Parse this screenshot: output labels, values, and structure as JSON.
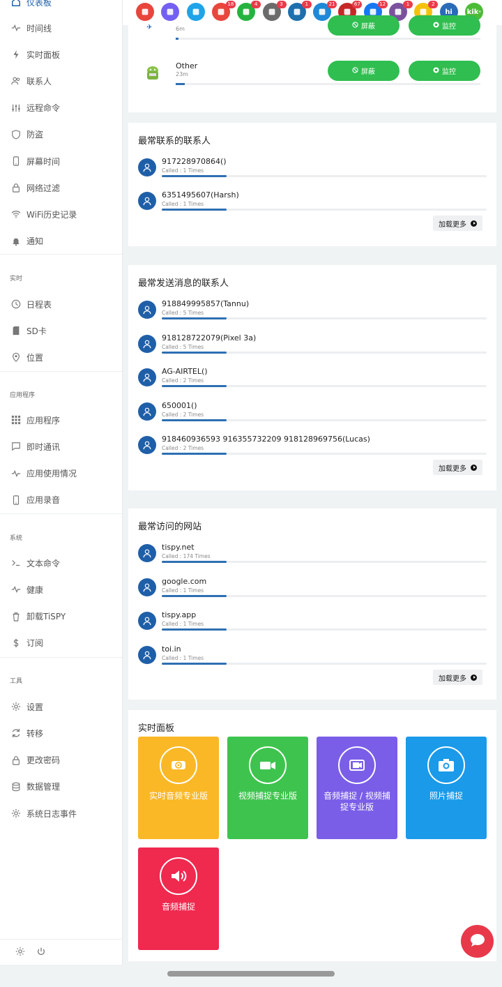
{
  "sidebar": {
    "top_partial": "仪表板",
    "items_main": [
      {
        "label": "时间线",
        "icon": "pulse-icon"
      },
      {
        "label": "实时面板",
        "icon": "bolt-icon"
      },
      {
        "label": "联系人",
        "icon": "users-icon"
      },
      {
        "label": "远程命令",
        "icon": "sliders-icon"
      },
      {
        "label": "防盗",
        "icon": "shield-icon"
      },
      {
        "label": "屏幕时间",
        "icon": "phone-icon"
      },
      {
        "label": "网络过滤",
        "icon": "lock-icon"
      },
      {
        "label": "WiFi历史记录",
        "icon": "wifi-icon"
      },
      {
        "label": "通知",
        "icon": "bell-icon"
      }
    ],
    "section_realtime": "实时",
    "items_realtime": [
      {
        "label": "日程表",
        "icon": "clock-icon"
      },
      {
        "label": "SD卡",
        "icon": "sdcard-icon"
      },
      {
        "label": "位置",
        "icon": "location-icon"
      }
    ],
    "section_apps": "应用程序",
    "items_apps": [
      {
        "label": "应用程序",
        "icon": "grid-icon"
      },
      {
        "label": "即时通讯",
        "icon": "chat-icon"
      },
      {
        "label": "应用使用情况",
        "icon": "pulse-icon"
      },
      {
        "label": "应用录音",
        "icon": "phone-icon"
      }
    ],
    "section_system": "系统",
    "items_system": [
      {
        "label": "文本命令",
        "icon": "terminal-icon"
      },
      {
        "label": "健康",
        "icon": "pulse-icon"
      },
      {
        "label": "卸载TiSPY",
        "icon": "trash-icon"
      },
      {
        "label": "订阅",
        "icon": "dollar-icon"
      }
    ],
    "section_tools": "工具",
    "items_tools": [
      {
        "label": "设置",
        "icon": "gear-icon"
      },
      {
        "label": "转移",
        "icon": "refresh-icon"
      },
      {
        "label": "更改密码",
        "icon": "lock-icon"
      },
      {
        "label": "数据管理",
        "icon": "database-icon"
      },
      {
        "label": "系统日志事件",
        "icon": "gear-icon"
      }
    ]
  },
  "topbar": {
    "apps": [
      {
        "name": "video-app",
        "color": "#e8453c",
        "badge": ""
      },
      {
        "name": "viber-app",
        "color": "#7360f2",
        "badge": ""
      },
      {
        "name": "messages-app",
        "color": "#1ea4e9",
        "badge": ""
      },
      {
        "name": "gallery-app",
        "color": "#e9453d",
        "badge": "18"
      },
      {
        "name": "whatsapp-app",
        "color": "#25b33f",
        "badge": "4"
      },
      {
        "name": "keyboard-app",
        "color": "#6b6b6b",
        "badge": "3"
      },
      {
        "name": "device-app",
        "color": "#1d6fae",
        "badge": "1"
      },
      {
        "name": "notification-app",
        "color": "#1e88d9",
        "badge": "21"
      },
      {
        "name": "browser-app",
        "color": "#c62828",
        "badge": "67"
      },
      {
        "name": "facebook-app",
        "color": "#1877f2",
        "badge": "12"
      },
      {
        "name": "viber-app-2",
        "color": "#7b519d",
        "badge": "1"
      },
      {
        "name": "email-app",
        "color": "#f4c20d",
        "badge": "2"
      },
      {
        "name": "hike-app",
        "color": "#2a6bb8",
        "badge": "",
        "text": "hi"
      },
      {
        "name": "kik-app",
        "color": "#4cbc36",
        "badge": "",
        "text": "kik·"
      }
    ]
  },
  "app_usage": {
    "rows": [
      {
        "name": "",
        "time": "6m",
        "progress": 0.01
      },
      {
        "name": "Other",
        "time": "23m",
        "progress": 0.03
      }
    ],
    "block_label": "屏蔽",
    "monitor_label": "监控"
  },
  "top_contacts": {
    "title": "最常联系的联系人",
    "rows": [
      {
        "name": "917228970864()",
        "sub": "Called : 1 Times",
        "progress": 0.2
      },
      {
        "name": "6351495607(Harsh)",
        "sub": "Called : 1 Times",
        "progress": 0.2
      }
    ],
    "load_more": "加载更多"
  },
  "top_messaged": {
    "title": "最常发送消息的联系人",
    "rows": [
      {
        "name": "918849995857(Tannu)",
        "sub": "Called : 5 Times",
        "progress": 0.2
      },
      {
        "name": "918128722079(Pixel 3a)",
        "sub": "Called : 5 Times",
        "progress": 0.2
      },
      {
        "name": "AG-AIRTEL()",
        "sub": "Called : 2 Times",
        "progress": 0.2
      },
      {
        "name": "650001()",
        "sub": "Called : 2 Times",
        "progress": 0.2
      },
      {
        "name": "918460936593 916355732209 918128969756(Lucas)",
        "sub": "Called : 2 Times",
        "progress": 0.2
      }
    ],
    "load_more": "加载更多"
  },
  "top_sites": {
    "title": "最常访问的网站",
    "rows": [
      {
        "name": "tispy.net",
        "sub": "Called : 174 Times",
        "progress": 0.2
      },
      {
        "name": "google.com",
        "sub": "Called : 1 Times",
        "progress": 0.2
      },
      {
        "name": "tispy.app",
        "sub": "Called : 1 Times",
        "progress": 0.2
      },
      {
        "name": "toi.in",
        "sub": "Called : 1 Times",
        "progress": 0.2
      }
    ],
    "load_more": "加载更多"
  },
  "live_panel": {
    "title": "实时面板",
    "tiles": [
      {
        "label": "实时音频专业版",
        "color": "#fbb826",
        "icon": "live-audio-icon"
      },
      {
        "label": "视频捕捉专业版",
        "color": "#3ec44e",
        "icon": "video-camera-icon"
      },
      {
        "label": "音频捕捉 / 视频捕捉专业版",
        "color": "#7a5ee8",
        "icon": "screen-record-icon"
      },
      {
        "label": "照片捕捉",
        "color": "#1a9ae9",
        "icon": "camera-icon"
      },
      {
        "label": "音频捕捉",
        "color": "#f0294f",
        "icon": "speaker-icon"
      }
    ]
  }
}
